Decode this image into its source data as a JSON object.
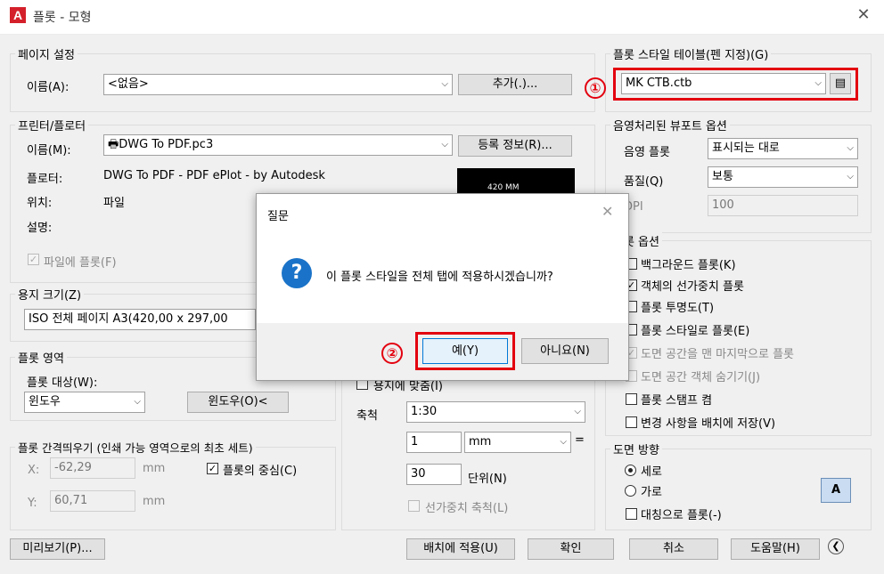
{
  "window": {
    "title": "플롯 - 모형",
    "app_icon": "A"
  },
  "page_setup": {
    "label": "페이지 설정",
    "name_label": "이름(A):",
    "name_value": "<없음>",
    "add_button": "추가(.)..."
  },
  "printer": {
    "label": "프린터/플로터",
    "name_label": "이름(M):",
    "name_value": "DWG To PDF.pc3",
    "properties_button": "등록 정보(R)...",
    "plotter_label": "플로터:",
    "plotter_value": "DWG To PDF - PDF ePlot - by Autodesk",
    "location_label": "위치:",
    "location_value": "파일",
    "description_label": "설명:",
    "plot_to_file_label": "파일에 플롯(F)",
    "preview_text": "420 MM"
  },
  "paper_size": {
    "label": "용지 크기(Z)",
    "value": "ISO 전체 페이지 A3(420,00 x 297,00"
  },
  "plot_area": {
    "label": "플롯 영역",
    "what_label": "플롯 대상(W):",
    "what_value": "윈도우",
    "window_button": "윈도우(O)<"
  },
  "plot_offset": {
    "label": "플롯 간격띄우기 (인쇄 가능 영역으로의 최초 세트)",
    "x_label": "X:",
    "x_value": "-62,29",
    "y_label": "Y:",
    "y_value": "60,71",
    "unit": "mm",
    "center_label": "플롯의 중심(C)"
  },
  "plot_scale": {
    "fit_label": "용지에 맞춤(I)",
    "scale_label": "축척",
    "scale_value": "1:30",
    "value1": "1",
    "unit_value": "mm",
    "equals": "=",
    "value2": "30",
    "units_label": "단위(N)",
    "lineweights_label": "선가중치 축척(L)"
  },
  "plot_style_table": {
    "label": "플롯 스타일 테이블(펜 지정)(G)",
    "value": "MK CTB.ctb",
    "marker": "①"
  },
  "shaded_viewport": {
    "label": "음영처리된 뷰포트 옵션",
    "shade_label": "음영 플롯",
    "shade_value": "표시되는 대로",
    "quality_label": "품질(Q)",
    "quality_value": "보통",
    "dpi_label": "DPI",
    "dpi_value": "100"
  },
  "plot_options": {
    "label": "플롯 옵션",
    "items": [
      {
        "label": "백그라운드 플롯(K)",
        "checked": "false"
      },
      {
        "label": "객체의 선가중치 플롯",
        "checked": "true"
      },
      {
        "label": "플롯 투명도(T)",
        "checked": "false"
      },
      {
        "label": "플롯 스타일로 플롯(E)",
        "checked": "false"
      },
      {
        "label": "도면 공간을 맨 마지막으로 플롯",
        "checked": "true"
      },
      {
        "label": "도면 공간 객체 숨기기(J)",
        "checked": "false"
      },
      {
        "label": "플롯 스탬프 켬",
        "checked": "false"
      },
      {
        "label": "변경 사항을 배치에 저장(V)",
        "checked": "false"
      }
    ]
  },
  "orientation": {
    "label": "도면 방향",
    "portrait": "세로",
    "landscape": "가로",
    "upside_down": "대칭으로 플롯(-)",
    "icon_letter": "A"
  },
  "footer": {
    "preview": "미리보기(P)...",
    "apply": "배치에 적용(U)",
    "ok": "확인",
    "cancel": "취소",
    "help": "도움말(H)"
  },
  "dialog": {
    "title": "질문",
    "message": "이 플롯 스타일을 전체 탭에 적용하시겠습니까?",
    "yes": "예(Y)",
    "no": "아니요(N)",
    "marker": "②"
  },
  "colors": {
    "highlight": "#e3000f",
    "question_icon": "#1a73c8"
  }
}
